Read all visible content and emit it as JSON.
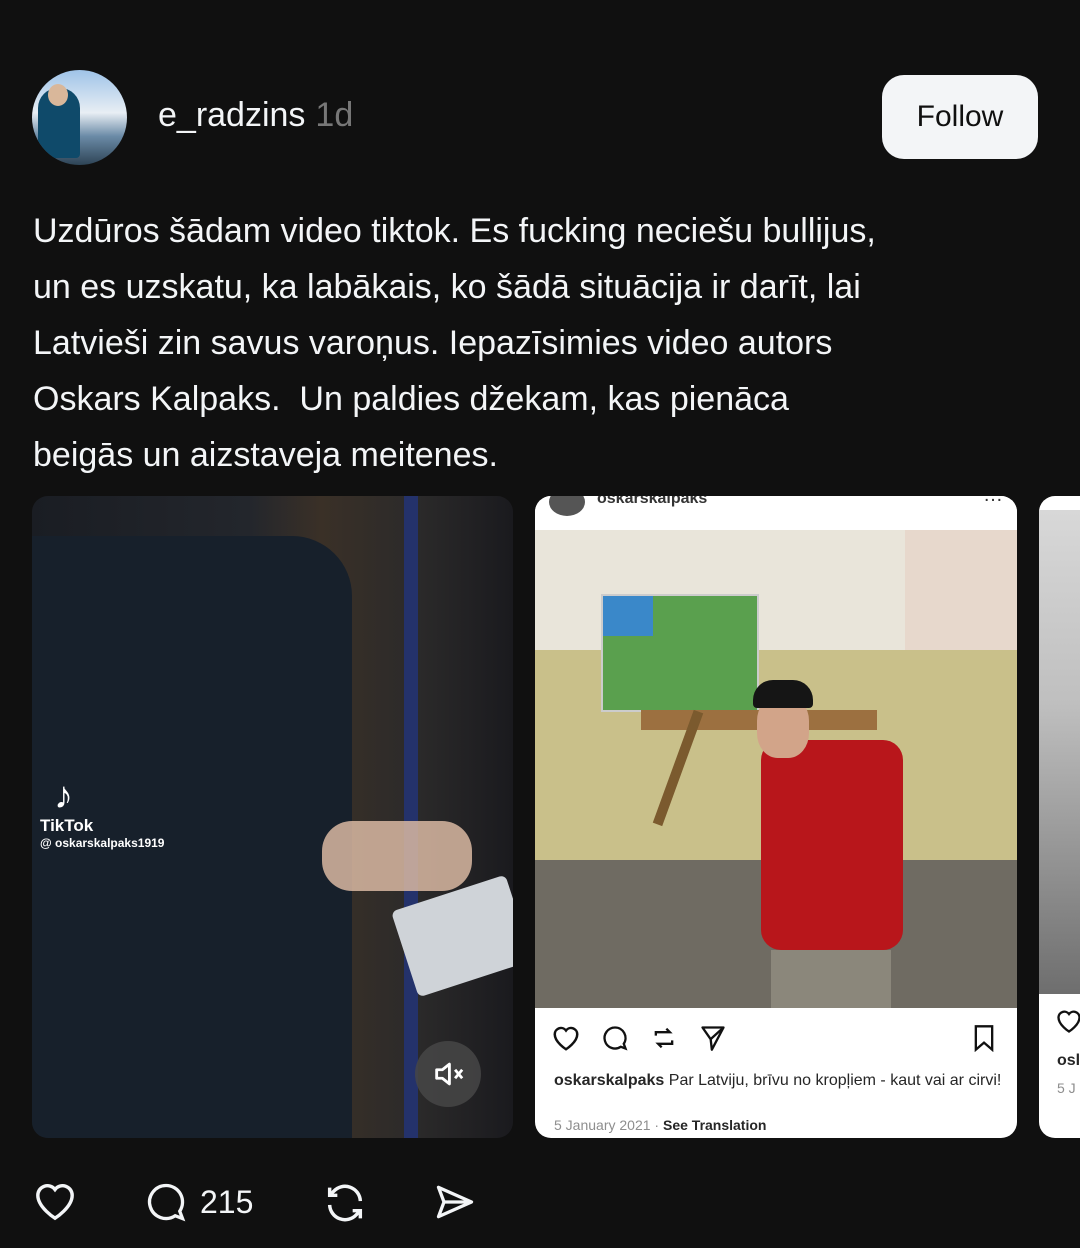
{
  "post": {
    "username": "e_radzins",
    "time": "1d",
    "follow_label": "Follow",
    "text": "Uzdūros šādam video tiktok. Es fucking neciešu bullijus,\nun es uzskatu, ka labākais, ko šādā situācija ir darīt, lai\nLatvieši zin savus varoņus. Iepazīsimies video autors\nOskars Kalpaks.  Un paldies džekam, kas pienāca\nbeigās un aizstaveja meitenes."
  },
  "media": {
    "video": {
      "tiktok_logo_text": "TikTok",
      "tiktok_handle": "@ oskarskalpaks1919"
    },
    "instagram_post": {
      "account_header": "oskarskalpaks",
      "caption_user": "oskarskalpaks",
      "caption_text": "Par Latviju, brīvu no kropļiem - kaut vai ar cirvi!",
      "date": "5 January 2021",
      "see_translation": "See Translation"
    },
    "third_partial": {
      "user": "osl",
      "date": "5 J"
    }
  },
  "actions": {
    "comments_count": "215"
  },
  "colors": {
    "background": "#101010",
    "text": "#f3f5f7",
    "muted": "#777777",
    "follow_bg": "#f3f5f7"
  },
  "icons": [
    "heart-icon",
    "comment-icon",
    "repost-icon",
    "share-icon",
    "mute-icon",
    "bookmark-icon"
  ]
}
